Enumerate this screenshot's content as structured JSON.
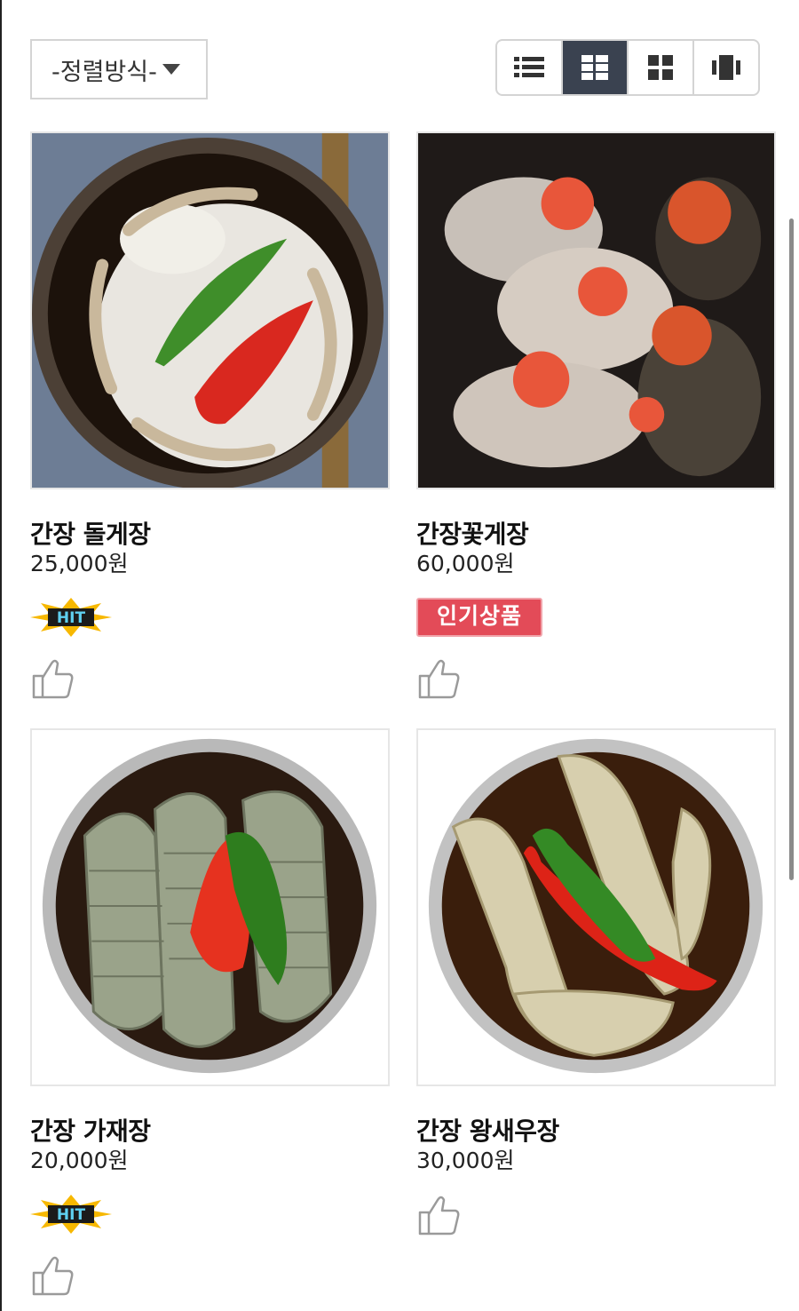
{
  "toolbar": {
    "sort_label": "-정렬방식-",
    "view_modes": [
      {
        "icon": "list-icon",
        "active": false
      },
      {
        "icon": "gallery-grid-icon",
        "active": true
      },
      {
        "icon": "grid-icon",
        "active": false
      },
      {
        "icon": "carousel-icon",
        "active": false
      }
    ]
  },
  "products": [
    {
      "name": "간장 돌게장",
      "price": "25,000원",
      "badge": "HIT",
      "image": "crab-in-soy-sauce"
    },
    {
      "name": "간장꽃게장",
      "price": "60,000원",
      "badge": "인기상품",
      "image": "blue-crab-with-roe"
    },
    {
      "name": "간장 가재장",
      "price": "20,000원",
      "badge": "HIT",
      "image": "mantis-shrimp-in-soy-sauce"
    },
    {
      "name": "간장 왕새우장",
      "price": "30,000원",
      "badge": "",
      "image": "king-prawn-in-soy-sauce"
    }
  ],
  "colors": {
    "active_view": "#3a4250",
    "popular_badge": "#e34b58",
    "hit_badge": "#f7b800"
  }
}
